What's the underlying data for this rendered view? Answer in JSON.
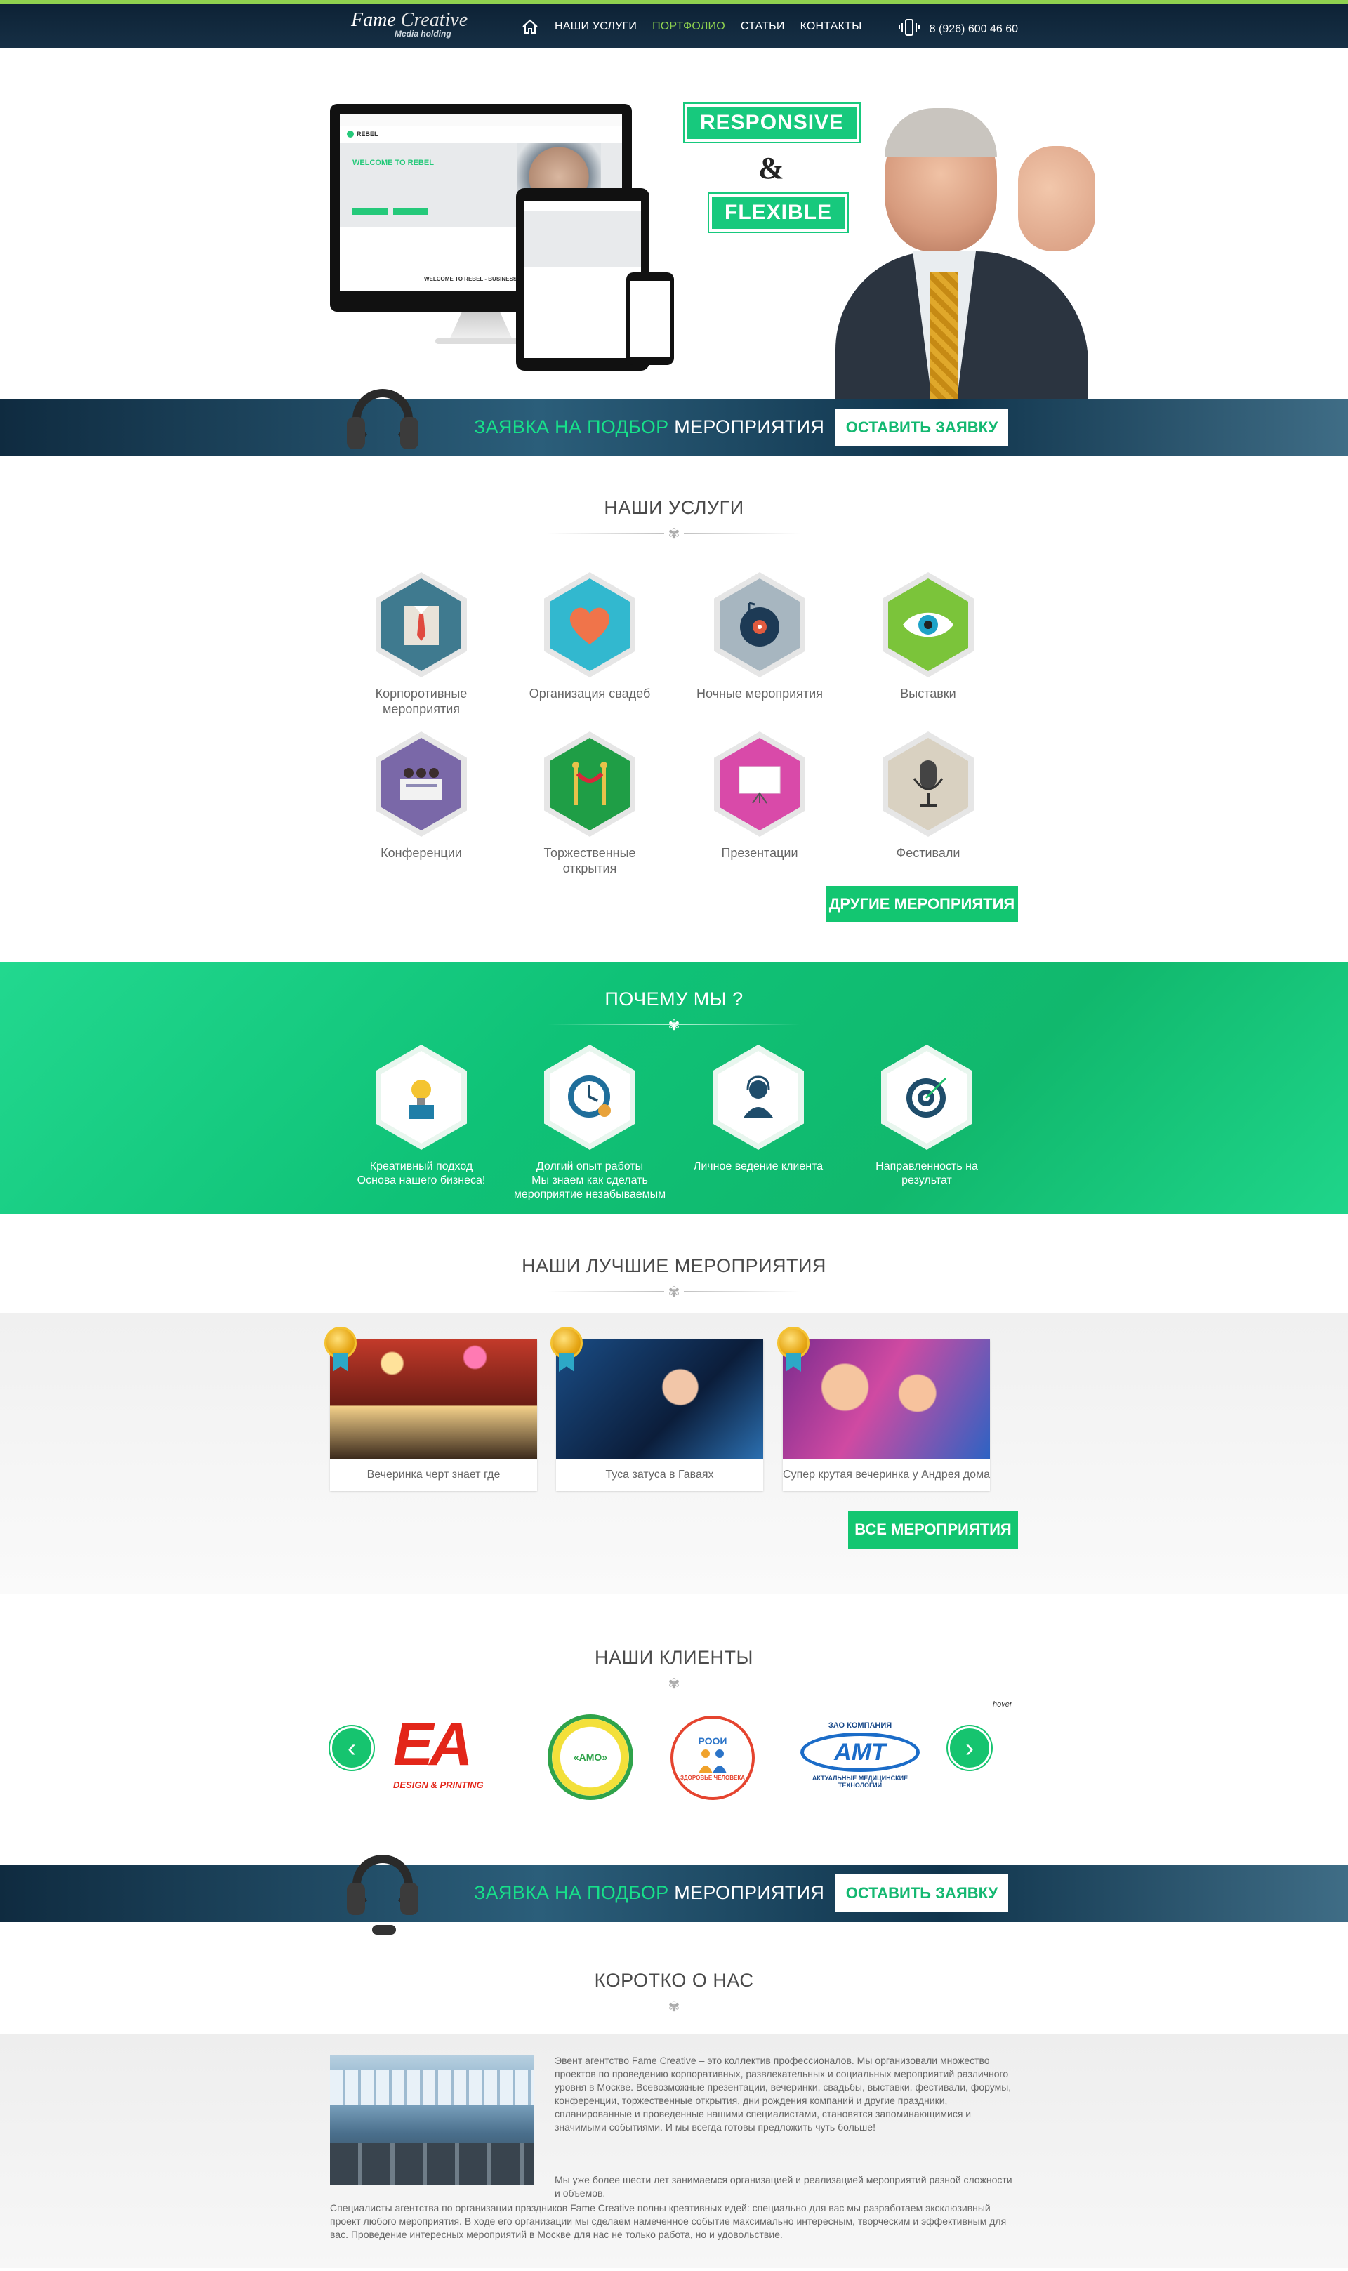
{
  "header": {
    "logo_main": "Fame",
    "logo_second": "Creative",
    "logo_sub": "Media holding",
    "nav": [
      "НАШИ УСЛУГИ",
      "ПОРТФОЛИО",
      "СТАТЬИ",
      "КОНТАКТЫ"
    ],
    "active_nav": "ПОРТФОЛИО",
    "phone": "8 (926) 600 46 60",
    "accent": "#8ed14f"
  },
  "hero": {
    "badge1": "RESPONSIVE",
    "amp": "&",
    "badge2": "FLEXIBLE",
    "mock_title": "WELCOME TO REBEL",
    "mock_brand": "REBEL",
    "mock_footer": "WELCOME TO REBEL - BUSINESS THEME BASED ON BOOTSTRAP 3"
  },
  "request_band": {
    "text_green1": "ЗАЯВКА НА ПОДБОР",
    "text_white": "МЕРОПРИЯТИЯ",
    "button": "ОСТАВИТЬ ЗАЯВКУ"
  },
  "services": {
    "title": "НАШИ УСЛУГИ",
    "items": [
      {
        "label": "Корпоротивные мероприятия",
        "icon": "suit-icon",
        "color": "#3f7a8f"
      },
      {
        "label": "Организация свадеб",
        "icon": "heart-icon",
        "color": "#32b8cf"
      },
      {
        "label": "Ночные мероприятия",
        "icon": "vinyl-icon",
        "color": "#a7b6c0"
      },
      {
        "label": "Выставки",
        "icon": "eye-icon",
        "color": "#7bc43a"
      },
      {
        "label": "Конференции",
        "icon": "conference-icon",
        "color": "#7a68a8"
      },
      {
        "label": "Торжественные открытия",
        "icon": "ribbon-icon",
        "color": "#1f9e46"
      },
      {
        "label": "Презентации",
        "icon": "presentation-icon",
        "color": "#d94aa9"
      },
      {
        "label": "Фестивали",
        "icon": "microphone-icon",
        "color": "#d9d1c1"
      }
    ],
    "more_button": "ДРУГИЕ МЕРОПРИЯТИЯ"
  },
  "why": {
    "title": "ПОЧЕМУ МЫ ?",
    "items": [
      {
        "label": "Креативный подход\nОснова нашего бизнеса!",
        "icon": "lightbulb-icon"
      },
      {
        "label": "Долгий опыт работы\nМы знаем как сделать\nмероприятие незабываемым",
        "icon": "clock-icon"
      },
      {
        "label": "Личное ведение клиента",
        "icon": "headset-person-icon"
      },
      {
        "label": "Направленность на результат",
        "icon": "target-icon"
      }
    ]
  },
  "best": {
    "title": "НАШИ ЛУЧШИЕ МЕРОПРИЯТИЯ",
    "cards": [
      {
        "caption": "Вечеринка черт знает где"
      },
      {
        "caption": "Туса затуса в Гаваях"
      },
      {
        "caption": "Супер крутая вечеринка у Андрея дома"
      }
    ],
    "all_button": "ВСЕ МЕРОПРИЯТИЯ"
  },
  "clients": {
    "title": "НАШИ КЛИЕНТЫ",
    "logos": [
      {
        "name": "EA Design & Printing",
        "text": "EA",
        "sub": "DESIGN & PRINTING"
      },
      {
        "name": "AMO",
        "text": "«АМО»"
      },
      {
        "name": "РООИ Здоровье человека",
        "text": "РООИ",
        "sub": "ЗДОРОВЬЕ ЧЕЛОВЕКА"
      },
      {
        "name": "ЗАО Компания АМТ",
        "text": "АМТ",
        "top": "ЗАО КОМПАНИЯ",
        "sub": "АКТУАЛЬНЫЕ МЕДИЦИНСКИЕ ТЕХНОЛОГИИ"
      }
    ],
    "hover_note": "hover"
  },
  "about": {
    "title": "КОРОТКО О НАС",
    "p1": "Эвент агентство Fame Creative – это коллектив профессионалов. Мы организовали множество проектов по проведению корпоративных, развлекательных и социальных мероприятий различного уровня в Москве. Всевозможные презентации, вечеринки, свадьбы, выставки, фестивали, форумы, конференции, торжественные открытия, дни рождения компаний и другие праздники, спланированные и проведенные нашими специалистами, становятся запоминающимися и значимыми событиями. И мы всегда готовы предложить чуть больше!",
    "p2": "Мы уже более шести лет занимаемся организацией и реализацией мероприятий разной сложности и объемов.",
    "p3": "Специалисты агентства по организации праздников Fame Creative полны креативных идей: специально для вас мы разработаем эксклюзивный проект любого мероприятия. В ходе его организации мы сделаем намеченное событие максимально интересным, творческим и эффективным для вас. Проведение интересных мероприятий в Москве для нас не только работа, но и удовольствие."
  }
}
